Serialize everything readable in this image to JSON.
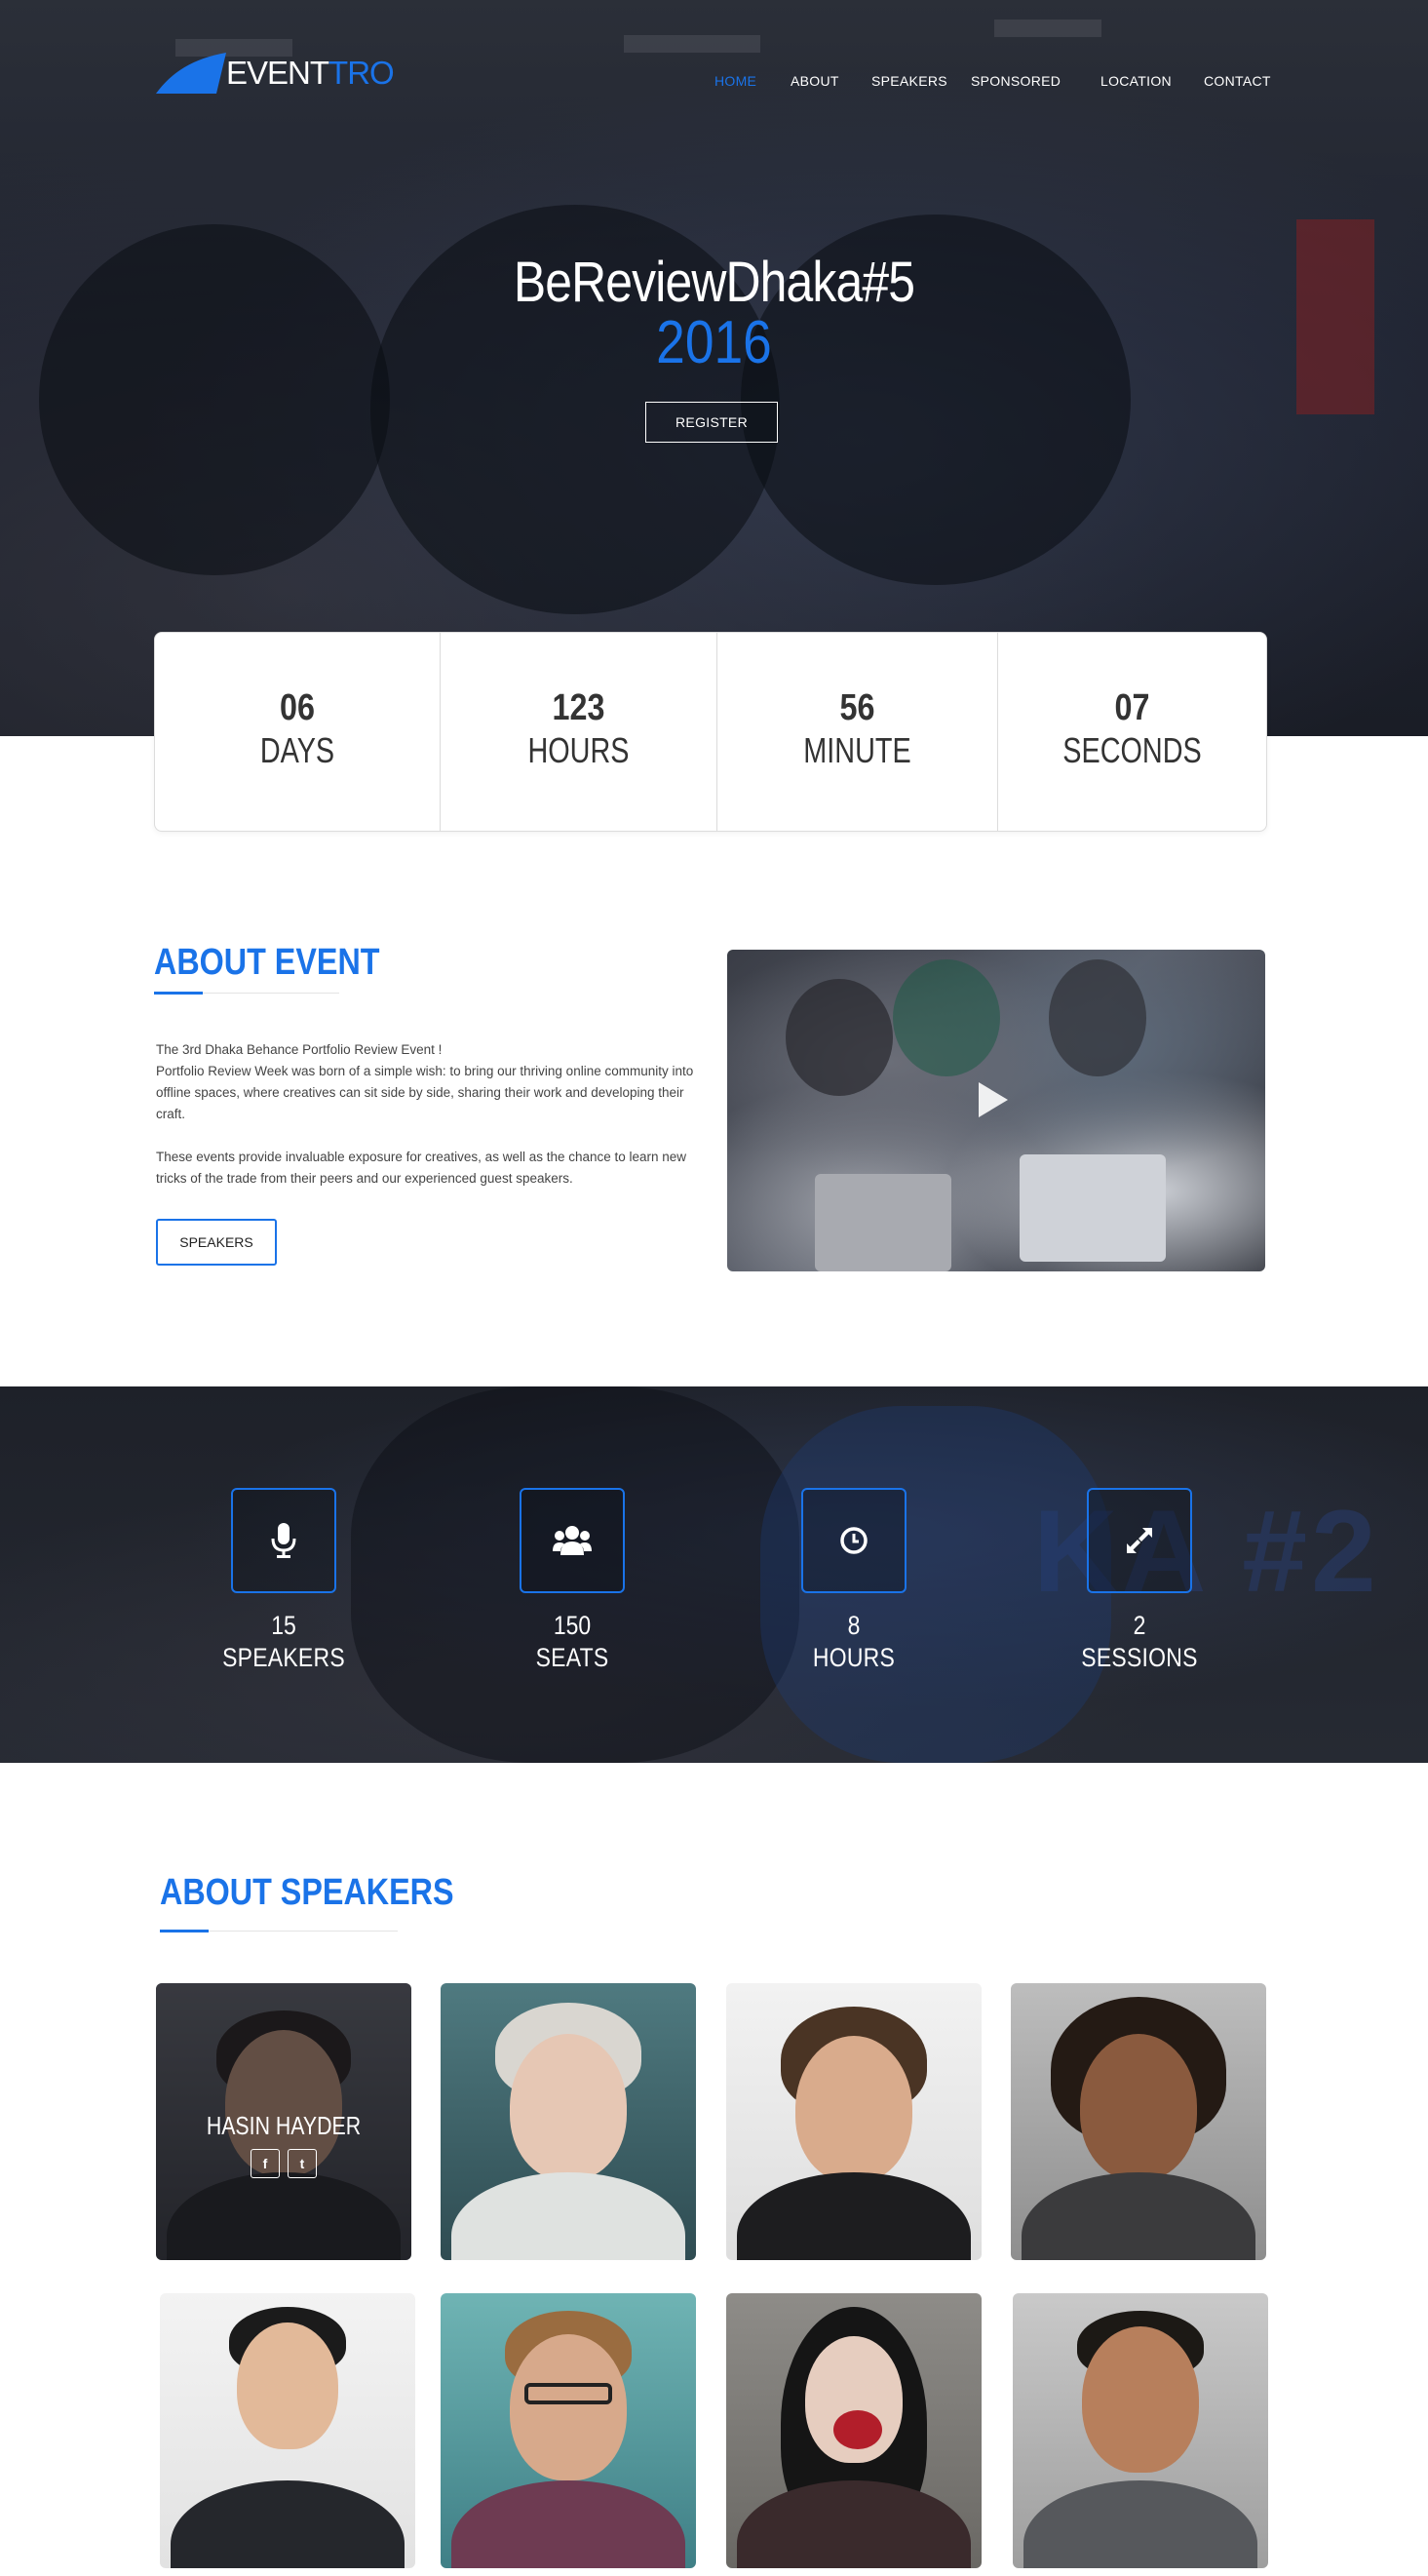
{
  "brand": {
    "logo_part1": "EVENT",
    "logo_part2": "TRO",
    "accent_color": "#1a73e8"
  },
  "nav": {
    "items": [
      {
        "label": "HOME",
        "active": true
      },
      {
        "label": "ABOUT",
        "active": false
      },
      {
        "label": "SPEAKERS",
        "active": false
      },
      {
        "label": "SPONSORED",
        "active": false
      },
      {
        "label": "LOCATION",
        "active": false
      },
      {
        "label": "CONTACT",
        "active": false
      }
    ]
  },
  "hero": {
    "title": "BeReviewDhaka#5",
    "year": "2016",
    "register_label": "REGISTER"
  },
  "countdown": [
    {
      "value": "06",
      "label": "DAYS"
    },
    {
      "value": "123",
      "label": "HOURS"
    },
    {
      "value": "56",
      "label": "MINUTE"
    },
    {
      "value": "07",
      "label": "SECONDS"
    }
  ],
  "about": {
    "title": "ABOUT EVENT",
    "line1": "The 3rd  Dhaka Behance Portfolio Review Event !",
    "line2": "Portfolio Review Week was born of a simple wish: to bring our thriving online community into offline spaces, where creatives can sit side by side, sharing their work and developing their craft.",
    "para2": "These events provide invaluable exposure for creatives, as well as the chance to learn new tricks of the trade from their peers and our experienced guest speakers.",
    "button_label": "SPEAKERS",
    "video_icon": "play-icon"
  },
  "stats": [
    {
      "icon": "microphone-icon",
      "value": "15",
      "label": "SPEAKERS"
    },
    {
      "icon": "users-icon",
      "value": "150",
      "label": "SEATS"
    },
    {
      "icon": "clock-icon",
      "value": "8",
      "label": "HOURS"
    },
    {
      "icon": "expand-icon",
      "value": "2",
      "label": "SESSIONS"
    }
  ],
  "stats_watermark": "KA #2",
  "speakers": {
    "title": "ABOUT SPEAKERS",
    "featured_name": "HASIN HAYDER",
    "social_facebook": "f",
    "social_twitter": "t"
  }
}
